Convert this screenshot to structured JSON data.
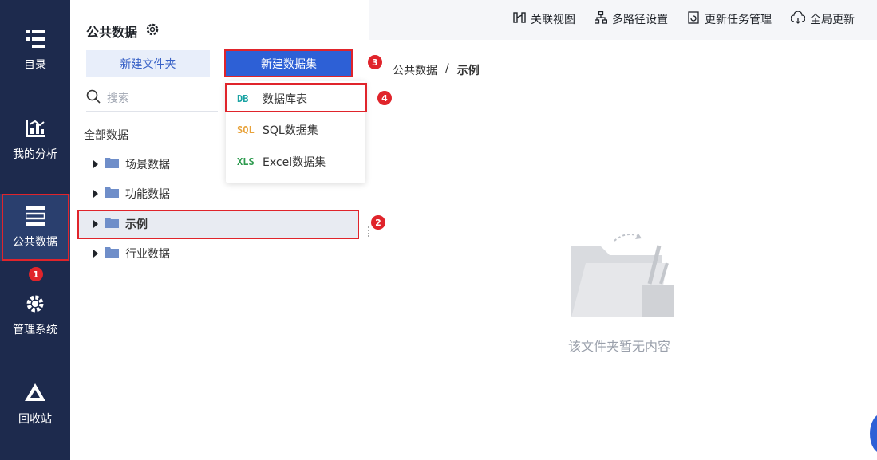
{
  "nav": {
    "items": [
      {
        "label": "目录",
        "icon": "catalog-icon"
      },
      {
        "label": "我的分析",
        "icon": "analysis-icon"
      },
      {
        "label": "公共数据",
        "icon": "public-data-icon"
      },
      {
        "label": "管理系统",
        "icon": "gear-icon"
      },
      {
        "label": "回收站",
        "icon": "recycle-icon"
      }
    ],
    "active": 2
  },
  "side": {
    "title": "公共数据",
    "new_folder_label": "新建文件夹",
    "new_dataset_label": "新建数据集",
    "search_placeholder": "搜索",
    "all_data_label": "全部数据",
    "tree": [
      {
        "label": "场景数据"
      },
      {
        "label": "功能数据"
      },
      {
        "label": "示例",
        "selected": true
      },
      {
        "label": "行业数据"
      }
    ]
  },
  "dropdown": {
    "items": [
      {
        "icon_text": "DB",
        "label": "数据库表",
        "color": "#1aa3a3"
      },
      {
        "icon_text": "SQL",
        "label": "SQL数据集",
        "color": "#e8a23a"
      },
      {
        "icon_text": "XLS",
        "label": "Excel数据集",
        "color": "#2e9b4f"
      }
    ]
  },
  "topbar": {
    "items": [
      {
        "label": "关联视图",
        "icon": "relation-view-icon"
      },
      {
        "label": "多路径设置",
        "icon": "multipath-icon"
      },
      {
        "label": "更新任务管理",
        "icon": "update-task-icon"
      },
      {
        "label": "全局更新",
        "icon": "cloud-refresh-icon"
      }
    ]
  },
  "breadcrumb": {
    "root": "公共数据",
    "sep": "/",
    "current": "示例"
  },
  "empty_text": "该文件夹暂无内容",
  "badges": [
    "1",
    "2",
    "3",
    "4"
  ],
  "colors": {
    "nav_bg": "#1d2a4d",
    "primary": "#2d60d6",
    "highlight": "#e0242b"
  }
}
